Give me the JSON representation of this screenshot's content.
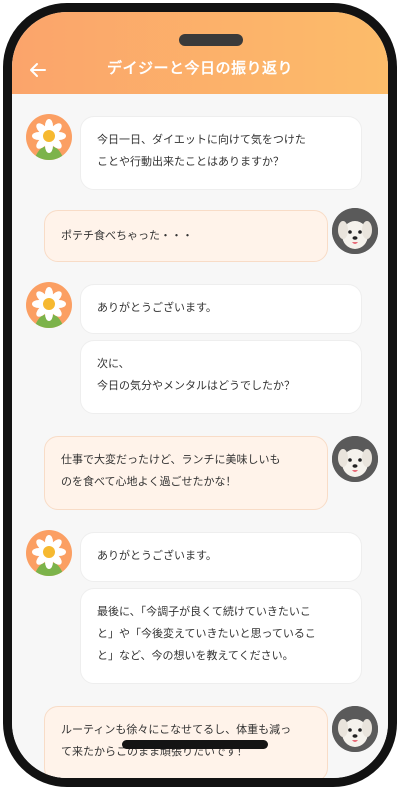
{
  "header": {
    "title": "デイジーと今日の振り返り",
    "back_icon": "←",
    "bg_start": "#fba46b",
    "bg_end": "#fcbc6a"
  },
  "messages": [
    {
      "sender": "bot",
      "text": "今日一日、ダイエットに向けて気をつけた\nことや行動出来たことはありますか？"
    },
    {
      "sender": "user",
      "text": "ポテチ食べちゃった・・・"
    },
    {
      "sender": "bot",
      "text": "ありがとうございます。"
    },
    {
      "sender": "bot",
      "text": "次に、\n今日の気分やメンタルはどうでしたか？"
    },
    {
      "sender": "user",
      "text": "仕事で大変だったけど、ランチに美味しいも\nのを食べて心地よく過ごせたかな！"
    },
    {
      "sender": "bot",
      "text": "ありがとうございます。"
    },
    {
      "sender": "bot",
      "text": "最後に、「今調子が良くて続けていきたいこ\nと」や「今後変えていきたいと思っているこ\nと」など、今の想いを教えてください。"
    },
    {
      "sender": "user",
      "text": "ルーティンも徐々にこなせてるし、体重も減っ\nて来たからこのまま頑張りたいです！"
    }
  ],
  "colors": {
    "accent": "#fba46b",
    "user_bubble": "#fff3ea",
    "bot_bubble": "#ffffff",
    "frame": "#121212"
  },
  "icons": {
    "bot_avatar": "daisy-flower-icon",
    "user_avatar": "white-dog-avatar"
  }
}
